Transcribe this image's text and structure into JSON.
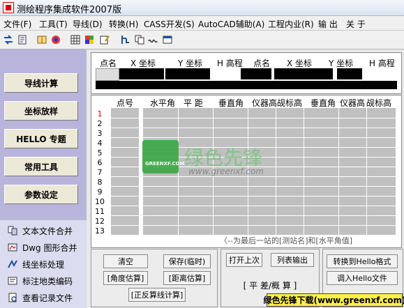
{
  "window": {
    "title": "测绘程序集成软件2007版"
  },
  "menu": [
    "文件(F)",
    "工具(T)",
    "导线(D)",
    "转换(H)",
    "CASS开发(S)",
    "AutoCAD辅助(A)",
    "工程内业(R)",
    "输 出",
    "关 于"
  ],
  "toolbar_icons": [
    "convert-icon",
    "document-icon",
    "open-book-icon",
    "color-icon",
    "grid-icon",
    "multicolor-icon",
    "edit-icon",
    "branch-icon",
    "copy-icon",
    "wave-icon",
    "window-icon"
  ],
  "nav": [
    "导线计算",
    "坐标放样",
    "HELLO 专题",
    "常用工具",
    "参数设定"
  ],
  "tools": [
    {
      "label": "文本文件合并",
      "icon": "text-merge-icon"
    },
    {
      "label": "Dwg 图形合并",
      "icon": "dwg-merge-icon"
    },
    {
      "label": "线坐标处理",
      "icon": "line-coord-icon"
    },
    {
      "label": "标注地类编码",
      "icon": "tag-icon"
    },
    {
      "label": "查看记录文件",
      "icon": "log-icon"
    }
  ],
  "coord_headers": [
    "点名",
    "X 坐标",
    "Y 坐标",
    "H 高程",
    "点名",
    "X 坐标",
    "Y 坐标",
    "H 高程"
  ],
  "grid_headers": [
    "点号",
    "水平角",
    "平 距",
    "垂直角",
    "仪器高",
    "觇标高",
    "垂直角",
    "仪器高",
    "觇标高"
  ],
  "row_numbers": [
    "1",
    "2",
    "3",
    "4",
    "5",
    "6",
    "7",
    "8",
    "9",
    "10",
    "11",
    "12",
    "13"
  ],
  "note": "〈--为最后一站的[测站名]和[水平角值]",
  "buttons": {
    "clear": "清空",
    "save_temp": "保存(临时)",
    "angle_est": "[角度估算]",
    "dist_est": "[距离估算]",
    "inverse_calc": "[正反算线计算]",
    "open_last": "打开上次",
    "output_table": "列表输出",
    "diff": "[ 平 差/概 算 ]",
    "to_hello": "转换到Hello格式",
    "import_hello": "调入Hello文件"
  },
  "watermark": {
    "cn": "绿色先锋",
    "url": "www.greenxf.com",
    "badge": "GREENXF.COM"
  },
  "footer_tag": "绿色先锋下载(www.greenxf.com)"
}
